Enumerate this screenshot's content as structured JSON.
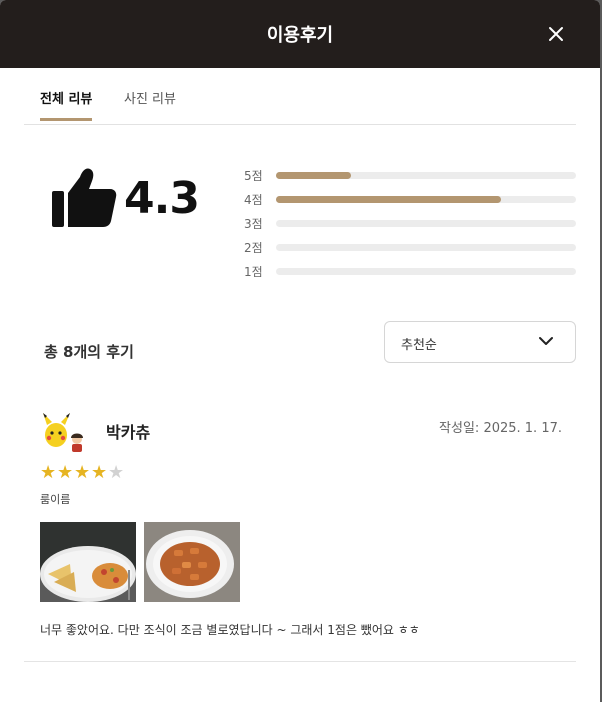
{
  "modal": {
    "title": "이용후기",
    "close_icon": "close-icon"
  },
  "tabs": [
    {
      "label": "전체 리뷰",
      "active": true
    },
    {
      "label": "사진 리뷰",
      "active": false
    }
  ],
  "summary": {
    "icon": "thumbs-up-icon",
    "average": "4.3",
    "distribution": [
      {
        "label": "5점",
        "fraction": 0.25
      },
      {
        "label": "4점",
        "fraction": 0.75
      },
      {
        "label": "3점",
        "fraction": 0
      },
      {
        "label": "2점",
        "fraction": 0
      },
      {
        "label": "1점",
        "fraction": 0
      }
    ],
    "accent_color": "#b39670"
  },
  "list": {
    "total_label": "총 8개의 후기",
    "sort": {
      "selected": "추천순",
      "icon": "chevron-down-icon"
    }
  },
  "reviews": [
    {
      "reviewer": "박카츄",
      "date": "작성일: 2025. 1. 17.",
      "rating": 4,
      "max_rating": 5,
      "room": "룸이름",
      "photos": [
        "breakfast-plate-photo",
        "tteokbokki-plate-photo"
      ],
      "text": "너무 좋았어요. 다만 조식이 조금 별로였답니다 ~ 그래서 1점은 뺐어요 ㅎㅎ"
    }
  ],
  "colors": {
    "header_bg": "#231e1c",
    "star_on": "#e6b422",
    "star_off": "#d2d2d2"
  }
}
